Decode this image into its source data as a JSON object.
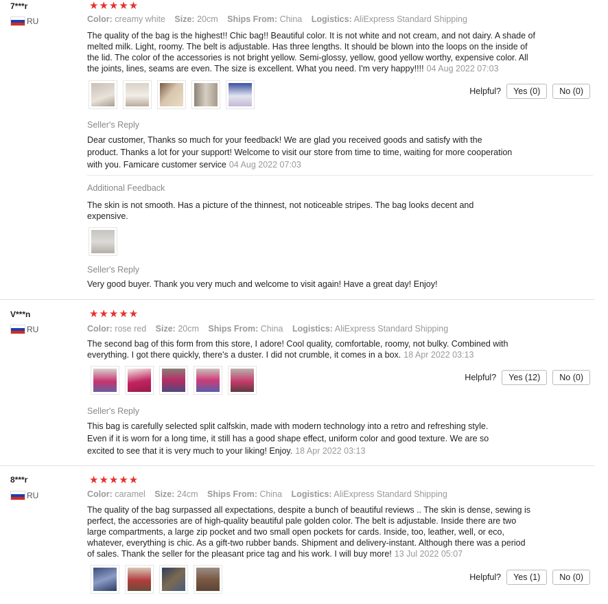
{
  "reviews": [
    {
      "user": "7***r",
      "country": "RU",
      "stars": "★★★★★",
      "color_label": "Color:",
      "color_value": "creamy white",
      "size_label": "Size:",
      "size_value": "20cm",
      "ships_label": "Ships From:",
      "ships_value": "China",
      "logistics_label": "Logistics:",
      "logistics_value": "AliExpress Standard Shipping",
      "text": "The quality of the bag is the highest!! Chic bag!! Beautiful color. It is not white and not cream, and not dairy. A shade of melted milk. Light, roomy. The belt is adjustable. Has three lengths. It should be blown into the loops on the inside of the lid. The color of the accessories is not bright yellow. Semi-glossy, yellow, good yellow worthy, expensive color. All the joints, lines, seams are even. The size is excellent. What you need. I'm very happy!!!!",
      "date": "04 Aug 2022 07:03",
      "helpful_label": "Helpful?",
      "yes_label": "Yes (0)",
      "no_label": "No (0)",
      "reply_label": "Seller's Reply",
      "reply_text": "Dear customer, Thanks so much for your feedback! We are glad you received goods and satisfy with the product. Thanks a lot for your support! Welcome to visit our store from time to time, waiting for more cooperation with you. Famicare customer service",
      "reply_date": "04 Aug 2022 07:03",
      "additional_label": "Additional Feedback",
      "additional_text": "The skin is not smooth. Has a picture of the thinnest, not noticeable stripes. The bag looks decent and expensive.",
      "reply2_label": "Seller's Reply",
      "reply2_text": "Very good buyer. Thank you very much and welcome to visit again! Have a great day! Enjoy!"
    },
    {
      "user": "V***n",
      "country": "RU",
      "stars": "★★★★★",
      "color_label": "Color:",
      "color_value": "rose red",
      "size_label": "Size:",
      "size_value": "20cm",
      "ships_label": "Ships From:",
      "ships_value": "China",
      "logistics_label": "Logistics:",
      "logistics_value": "AliExpress Standard Shipping",
      "text": "The second bag of this form from this store, I adore! Cool quality, comfortable, roomy, not bulky. Combined with everything. I got there quickly, there's a duster. I did not crumble, it comes in a box.",
      "date": "18 Apr 2022 03:13",
      "helpful_label": "Helpful?",
      "yes_label": "Yes (12)",
      "no_label": "No (0)",
      "reply_label": "Seller's Reply",
      "reply_text": "This bag is carefully selected split calfskin, made with modern technology into a retro and refreshing style. Even if it is worn for a long time, it still has a good shape effect, uniform color and good texture. We are so excited to see that it is very much to your liking! Enjoy.",
      "reply_date": "18 Apr 2022 03:13"
    },
    {
      "user": "8***r",
      "country": "RU",
      "stars": "★★★★★",
      "color_label": "Color:",
      "color_value": "caramel",
      "size_label": "Size:",
      "size_value": "24cm",
      "ships_label": "Ships From:",
      "ships_value": "China",
      "logistics_label": "Logistics:",
      "logistics_value": "AliExpress Standard Shipping",
      "text": "The quality of the bag surpassed all expectations, despite a bunch of beautiful reviews .. The skin is dense, sewing is perfect, the accessories are of high-quality beautiful pale golden color. The belt is adjustable. Inside there are two large compartments, a large zip pocket and two small open pockets for cards. Inside, too, leather, well, or eco, whatever, everything is chic. As a gift-two rubber bands. Shipment and delivery-instant. Although there was a period of sales. Thank the seller for the pleasant price tag and his work. I will buy more!",
      "date": "13 Jul 2022 05:07",
      "helpful_label": "Helpful?",
      "yes_label": "Yes (1)",
      "no_label": "No (0)"
    }
  ]
}
